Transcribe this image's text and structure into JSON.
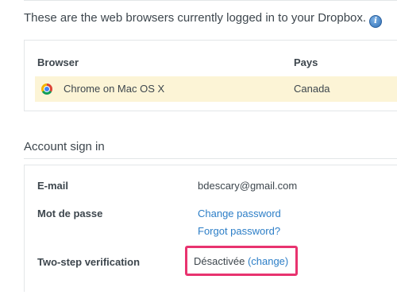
{
  "intro": {
    "text": "These are the web browsers currently logged in to your Dropbox.",
    "info_icon": "info-icon"
  },
  "browsers": {
    "columns": {
      "browser": "Browser",
      "country": "Pays"
    },
    "rows": [
      {
        "icon": "chrome-icon",
        "browser": "Chrome on Mac OS X",
        "country": "Canada"
      }
    ],
    "highlight_color": "#fcf4d6"
  },
  "account": {
    "title": "Account sign in",
    "email_label": "E-mail",
    "email_value": "bdescary@gmail.com",
    "password_label": "Mot de passe",
    "change_password": "Change password",
    "forgot_password": "Forgot password?",
    "two_step_label": "Two-step verification",
    "two_step_status": "Désactivée",
    "two_step_change": "(change)",
    "annotation_color": "#e8336f",
    "link_color": "#2c7ec7"
  }
}
